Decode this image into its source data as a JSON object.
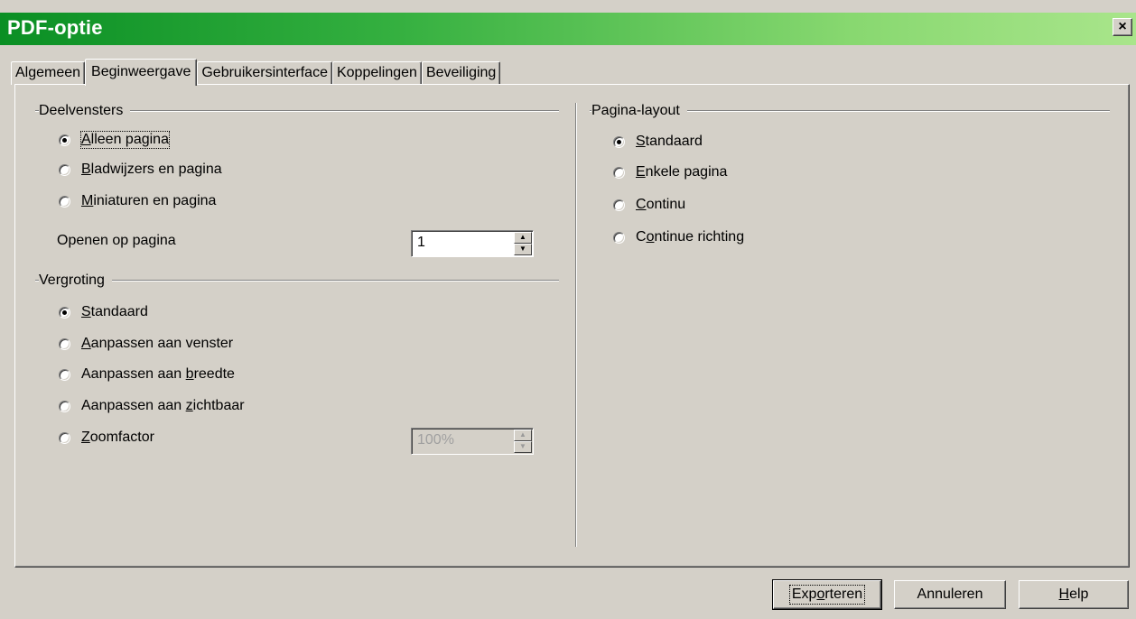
{
  "window": {
    "title": "PDF-optie",
    "close_glyph": "×"
  },
  "tabs": [
    {
      "label": "Algemeen"
    },
    {
      "label": "Beginweergave"
    },
    {
      "label": "Gebruikersinterface"
    },
    {
      "label": "Koppelingen"
    },
    {
      "label": "Beveiliging"
    }
  ],
  "active_tab": "Beginweergave",
  "panes": {
    "title": "Deelvensters",
    "options": [
      {
        "pre": "",
        "u": "A",
        "post": "lleen pagina",
        "checked": true
      },
      {
        "pre": "",
        "u": "B",
        "post": "ladwijzers en pagina",
        "checked": false
      },
      {
        "pre": "",
        "u": "M",
        "post": "iniaturen en pagina",
        "checked": false
      }
    ],
    "open_page_label": "Openen op pagina",
    "open_page_value": "1"
  },
  "magnification": {
    "title": "Vergroting",
    "options": [
      {
        "pre": "",
        "u": "S",
        "post": "tandaard",
        "checked": true
      },
      {
        "pre": "",
        "u": "A",
        "post": "anpassen aan venster",
        "checked": false
      },
      {
        "pre": "Aanpassen aan ",
        "u": "b",
        "post": "reedte",
        "checked": false
      },
      {
        "pre": "Aanpassen aan ",
        "u": "z",
        "post": "ichtbaar",
        "checked": false
      },
      {
        "pre": "",
        "u": "Z",
        "post": "oomfactor",
        "checked": false
      }
    ],
    "zoom_value": "100%"
  },
  "page_layout": {
    "title": "Pagina-layout",
    "options": [
      {
        "pre": "",
        "u": "S",
        "post": "tandaard",
        "checked": true
      },
      {
        "pre": "",
        "u": "E",
        "post": "nkele pagina",
        "checked": false
      },
      {
        "pre": "",
        "u": "C",
        "post": "ontinu",
        "checked": false
      },
      {
        "pre": "C",
        "u": "o",
        "post": "ntinue richting",
        "checked": false
      }
    ]
  },
  "buttons": {
    "export": {
      "pre": "Exp",
      "u": "o",
      "post": "rteren"
    },
    "cancel": {
      "pre": "Annuleren",
      "u": "",
      "post": ""
    },
    "help": {
      "pre": "",
      "u": "H",
      "post": "elp"
    }
  },
  "spin_arrows": {
    "up": "▲",
    "down": "▼"
  }
}
